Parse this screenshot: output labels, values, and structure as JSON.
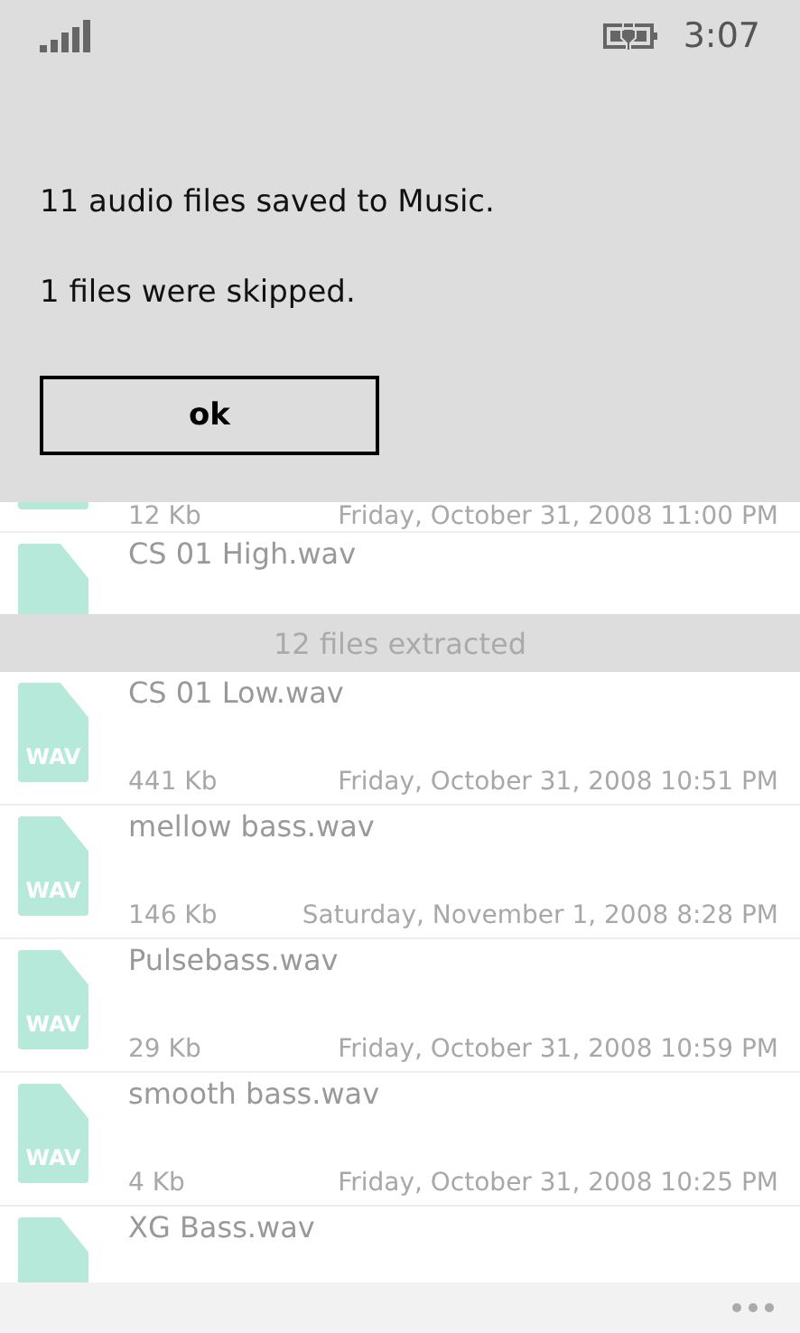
{
  "status_bar": {
    "time": "3:07"
  },
  "dialog": {
    "messages": [
      "11 audio files saved to Music.",
      "1 files were skipped."
    ],
    "button": "ok"
  },
  "list": {
    "items_above": [
      {
        "size": "12 Kb",
        "date": "Friday, October 31, 2008 11:00 PM"
      },
      {
        "name": "CS 01 High.wav"
      }
    ],
    "group_header": "12 files extracted",
    "items": [
      {
        "name": "CS 01 Low.wav",
        "icon_label": "WAV",
        "size": "441 Kb",
        "date": "Friday, October 31, 2008 10:51 PM"
      },
      {
        "name": "mellow bass.wav",
        "icon_label": "WAV",
        "size": "146 Kb",
        "date": "Saturday, November 1, 2008 8:28 PM"
      },
      {
        "name": "Pulsebass.wav",
        "icon_label": "WAV",
        "size": "29 Kb",
        "date": "Friday, October 31, 2008 10:59 PM"
      },
      {
        "name": "smooth bass.wav",
        "icon_label": "WAV",
        "size": "4 Kb",
        "date": "Friday, October 31, 2008 10:25 PM"
      },
      {
        "name": "XG Bass.wav"
      }
    ]
  }
}
